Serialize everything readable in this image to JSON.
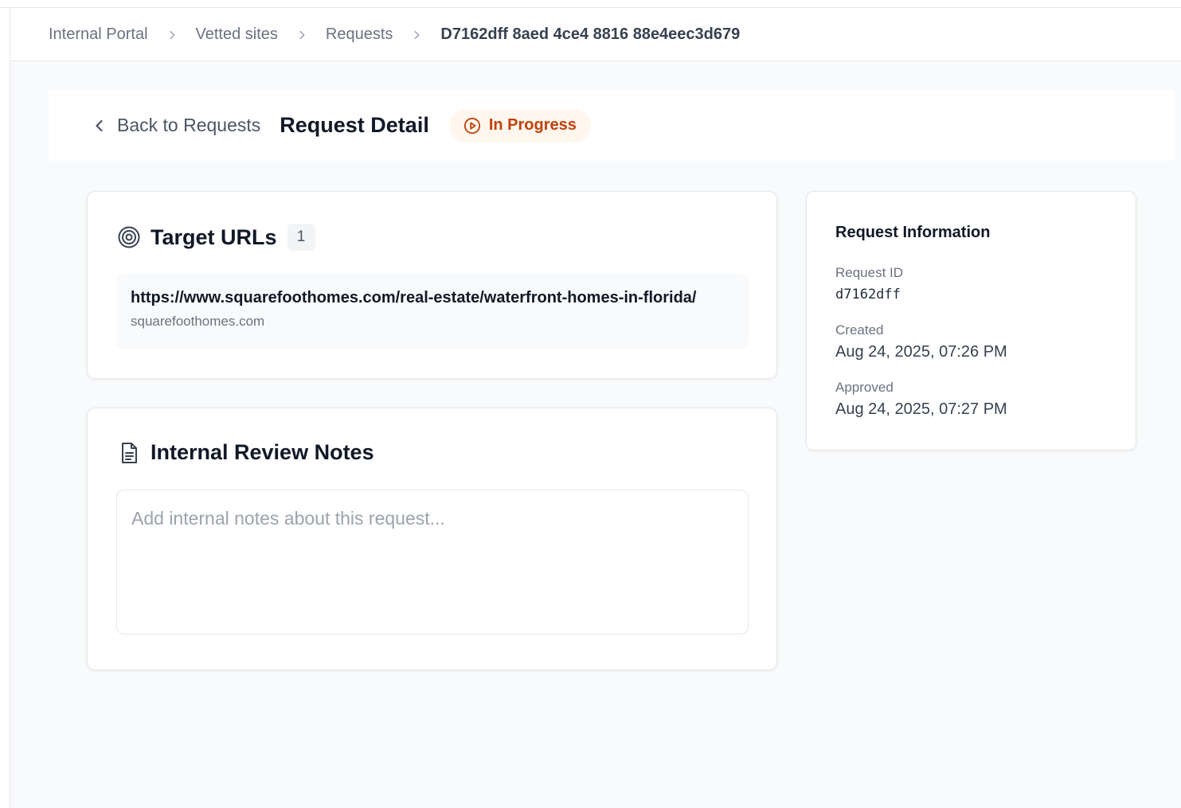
{
  "breadcrumb": {
    "items": [
      "Internal Portal",
      "Vetted sites",
      "Requests",
      "D7162dff 8aed 4ce4 8816 88e4eec3d679"
    ]
  },
  "header": {
    "back_label": "Back to Requests",
    "title": "Request Detail",
    "status": "In Progress"
  },
  "target_urls": {
    "title": "Target URLs",
    "count": "1",
    "items": [
      {
        "url": "https://www.squarefoothomes.com/real-estate/waterfront-homes-in-florida/",
        "domain": "squarefoothomes.com"
      }
    ]
  },
  "notes": {
    "title": "Internal Review Notes",
    "placeholder": "Add internal notes about this request...",
    "value": ""
  },
  "request_info": {
    "title": "Request Information",
    "fields": [
      {
        "label": "Request ID",
        "value": "d7162dff"
      },
      {
        "label": "Created",
        "value": "Aug 24, 2025, 07:26 PM"
      },
      {
        "label": "Approved",
        "value": "Aug 24, 2025, 07:27 PM"
      }
    ]
  },
  "colors": {
    "status_text": "#c2410c",
    "status_bg": "#fff7ed",
    "page_bg": "#f9fafb"
  },
  "icons": {
    "breadcrumb_separator": "chevron-right-icon",
    "back": "chevron-left-icon",
    "status": "play-circle-icon",
    "target_urls": "target-icon",
    "notes": "document-icon"
  }
}
